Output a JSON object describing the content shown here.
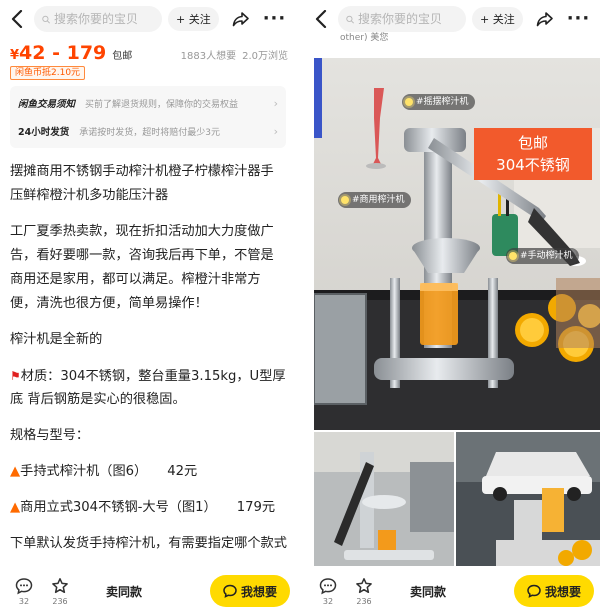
{
  "header": {
    "search_placeholder": "搜索你要的宝贝",
    "follow_label": "+ 关注"
  },
  "left": {
    "price_symbol": "¥",
    "price_range": "42 - 179",
    "free_shipping": "包邮",
    "wants_count": "1883人想要",
    "views_count": "2.0万浏览",
    "coin_badge": "闲鱼币抵2.10元",
    "notices": [
      {
        "key": "闲鱼交易须知",
        "value": "买前了解退货规则，保障你的交易权益"
      },
      {
        "key": "24小时发货",
        "value": "承诺按时发货，超时将赔付最少3元"
      }
    ],
    "description": {
      "title": "摆摊商用不锈钢手动榨汁机橙子柠檬榨汁器手压鲜榨橙汁机多功能压汁器",
      "body": "工厂夏季热卖款，现在折扣活动加大力度做广告，看好要哪一款，咨询我后再下单，不管是商用还是家用，都可以满足。榨橙汁非常方便，清洗也很方便，简单易操作！",
      "new_line": "榨汁机是全新的",
      "material_line_1": "材质：304不锈钢，整台重量3.15kg，U型厚",
      "material_line_2": "底 背后钢筋是实心的很稳固。",
      "spec_heading": "规格与型号：",
      "spec_1_name": "手持式榨汁机（图6）",
      "spec_1_price": "42元",
      "spec_2_name": "商用立式304不锈钢-大号（图1）",
      "spec_2_price": "179元",
      "order_note": "下单默认发货手持榨汁机，有需要指定哪个款式"
    }
  },
  "right": {
    "above_text": "other) 美您",
    "tags": [
      "#摇摆榨汁机",
      "#商用榨汁机",
      "#手动榨汁机"
    ],
    "promo_line_1": "包邮",
    "promo_line_2": "304不锈钢"
  },
  "bottom": {
    "comment_count": "32",
    "fav_count": "236",
    "buy_same_label": "卖同款",
    "want_label": "我想要"
  },
  "colors": {
    "price": "#ff4400",
    "want_button": "#ffda00",
    "promo_banner": "#f25a2c"
  }
}
